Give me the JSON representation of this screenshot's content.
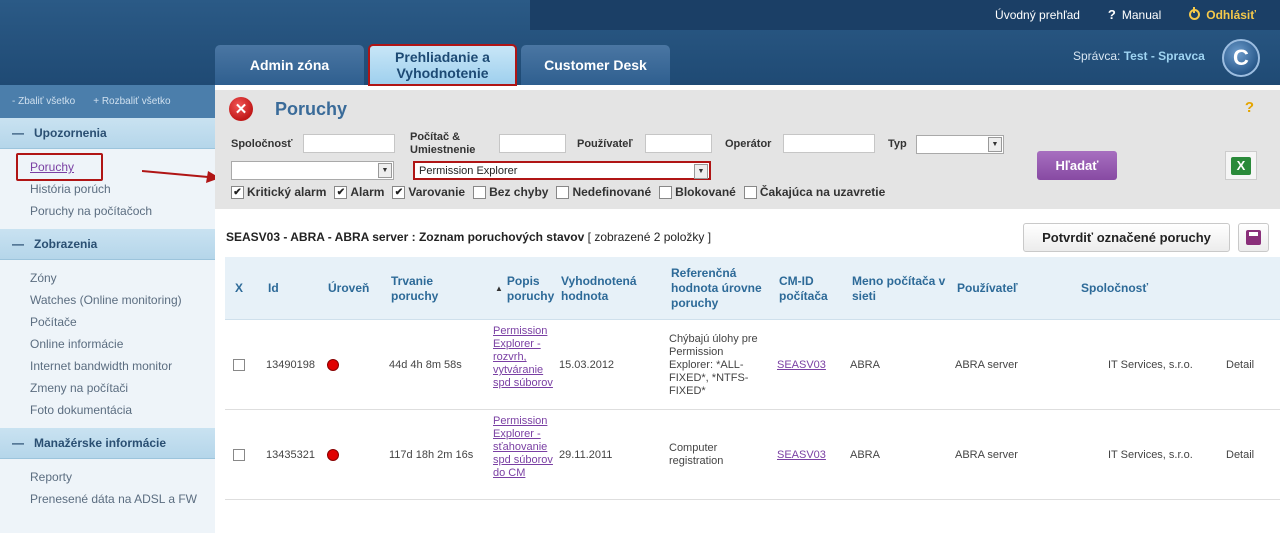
{
  "header": {
    "top_links": {
      "overview": "Úvodný prehľad",
      "manual": "Manual",
      "logout": "Odhlásiť"
    },
    "tabs": [
      "Admin zóna",
      "Prehliadanie a Vyhodnotenie",
      "Customer Desk"
    ],
    "user_label": "Správca:",
    "user_name": "Test - Spravca",
    "logo_letter": "C"
  },
  "sidebar": {
    "collapse_all": "- Zbaliť všetko",
    "expand_all": "+ Rozbaliť všetko",
    "sections": [
      {
        "title": "Upozornenia",
        "items": [
          "Poruchy",
          "História porúch",
          "Poruchy na počítačoch"
        ]
      },
      {
        "title": "Zobrazenia",
        "items": [
          "Zóny",
          "Watches (Online monitoring)",
          "Počítače",
          "Online informácie",
          "Internet bandwidth monitor",
          "Zmeny na počítači",
          "Foto dokumentácia"
        ]
      },
      {
        "title": "Manažérske informácie",
        "items": [
          "Reporty",
          "Prenesené dáta na ADSL a FW"
        ]
      }
    ]
  },
  "page": {
    "title": "Poruchy",
    "help": "?"
  },
  "filters": {
    "company_label": "Spoločnosť",
    "computer_label": "Počítač & Umiestnenie",
    "user_label": "Používateľ",
    "operator_label": "Operátor",
    "type_label": "Typ",
    "app_select_value": "Permission Explorer",
    "checkboxes": [
      {
        "label": "Kritický alarm",
        "checked": true
      },
      {
        "label": "Alarm",
        "checked": true
      },
      {
        "label": "Varovanie",
        "checked": true
      },
      {
        "label": "Bez chyby",
        "checked": false
      },
      {
        "label": "Nedefinované",
        "checked": false
      },
      {
        "label": "Blokované",
        "checked": false
      },
      {
        "label": "Čakajúca na uzavretie",
        "checked": false
      }
    ],
    "search_button": "Hľadať"
  },
  "list": {
    "title": "SEASV03 - ABRA - ABRA server : Zoznam poruchových stavov",
    "count": "[ zobrazené 2 položky ]",
    "confirm_button": "Potvrdiť označené poruchy"
  },
  "table": {
    "columns": [
      "X",
      "Id",
      "Úroveň",
      "Trvanie poruchy",
      "Popis poruchy",
      "Vyhodnotená hodnota",
      "Referenčná hodnota úrovne poruchy",
      "CM-ID počítača",
      "Meno počítača v sieti",
      "Používateľ",
      "Spoločnosť"
    ],
    "rows": [
      {
        "id": "13490198",
        "duration": "44d 4h 8m 58s",
        "description": "Permission Explorer - rozvrh, vytváranie spd súborov",
        "evaluated": "15.03.2012",
        "reference": "Chýbajú úlohy pre Permission Explorer: *ALL-FIXED*, *NTFS-FIXED*",
        "cmid": "SEASV03",
        "pc_name": "ABRA",
        "user": "ABRA server",
        "company": "IT Services, s.r.o.",
        "action": "Detail"
      },
      {
        "id": "13435321",
        "duration": "117d 18h 2m 16s",
        "description": "Permission Explorer - sťahovanie spd súborov do CM",
        "evaluated": "29.11.2011",
        "reference": "Computer registration",
        "cmid": "SEASV03",
        "pc_name": "ABRA",
        "user": "ABRA server",
        "company": "IT Services, s.r.o.",
        "action": "Detail"
      }
    ]
  },
  "colors": {
    "header_blue": "#2b5a86",
    "highlight_red": "#b01515",
    "search_purple": "#874aa3",
    "link_purple": "#7a3fa3",
    "alarm_red": "#e00000"
  }
}
